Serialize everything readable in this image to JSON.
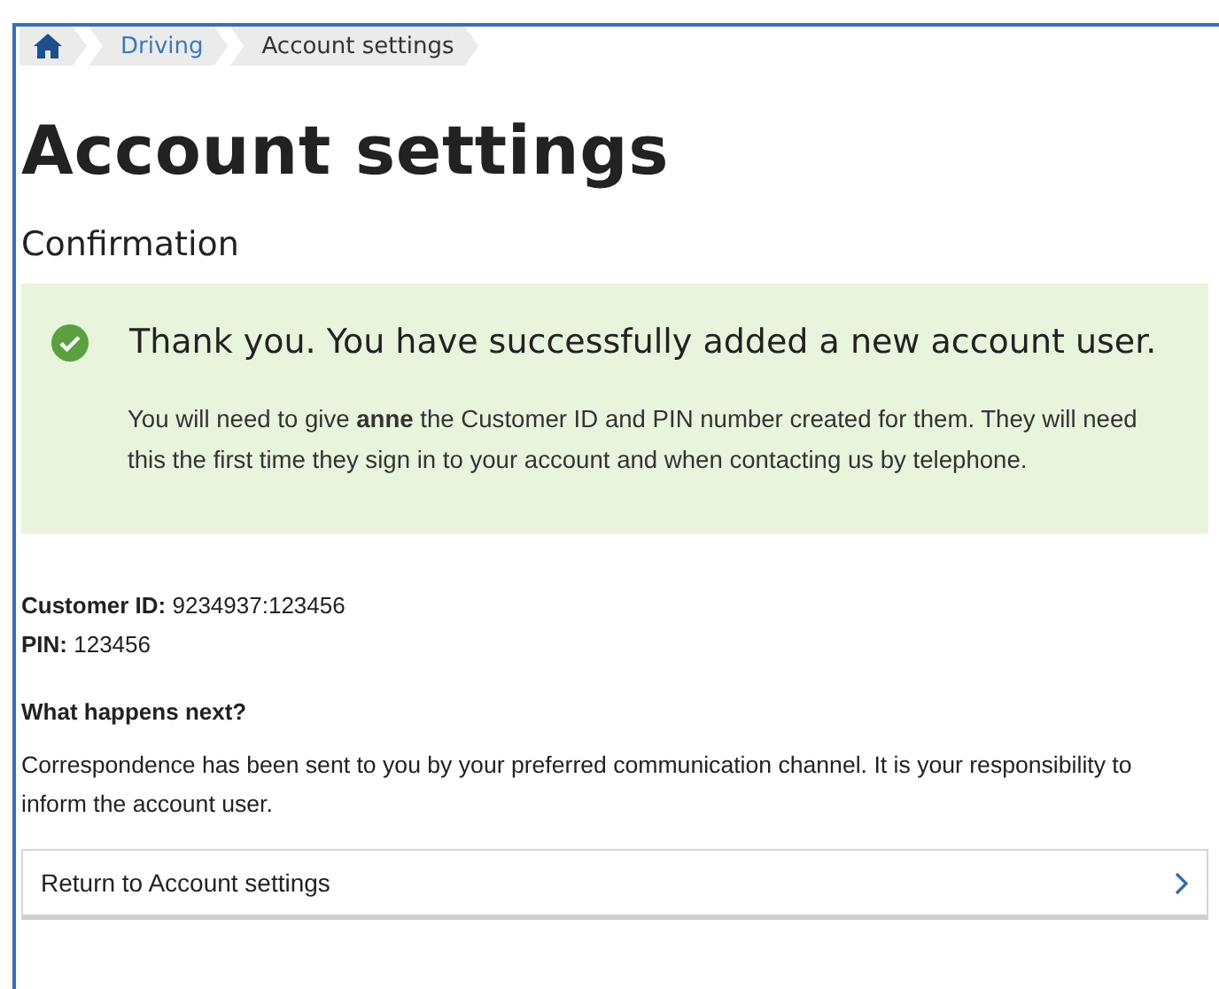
{
  "breadcrumb": [
    {
      "kind": "home"
    },
    {
      "kind": "link",
      "label": "Driving"
    },
    {
      "kind": "current",
      "label": "Account settings"
    }
  ],
  "page_title": "Account settings",
  "section_heading": "Confirmation",
  "success_panel": {
    "heading": "Thank you. You have successfully added a new account user.",
    "message": "You will need to give **anne** the Customer ID and PIN number created for them. They will need this the first time they sign in to your account and when contacting us by telephone."
  },
  "details": [
    "**Customer ID:** 9234937:123456",
    "**PIN:** 123456"
  ],
  "next_heading": "What happens next?",
  "next_text": "Correspondence has been sent to you by your preferred communication channel. It is your responsibility to inform the account user.",
  "return_link": {
    "label": "Return to Account settings"
  }
}
